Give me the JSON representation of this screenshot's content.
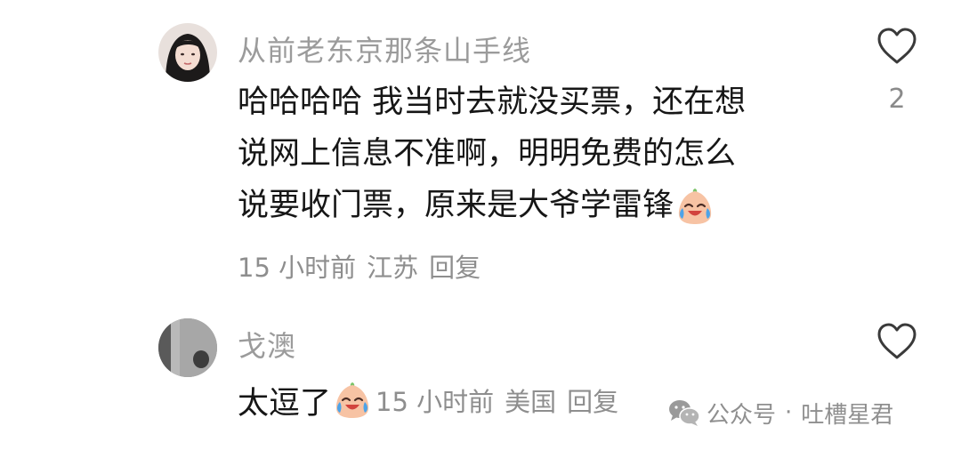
{
  "comments": [
    {
      "username": "从前老东京那条山手线",
      "body_lines": [
        "哈哈哈哈 我当时去就没买票，还在想",
        "说网上信息不准啊，明明免费的怎么",
        "说要收门票，原来是大爷学雷锋"
      ],
      "emoji_icon": "crying-laughing-emoji-icon",
      "time": "15 小时前",
      "location": "江苏",
      "reply_label": "回复",
      "like_count": "2",
      "heart_icon": "heart-outline-icon"
    },
    {
      "username": "戈澳",
      "text": "太逗了",
      "emoji_icon": "crying-laughing-emoji-icon",
      "time": "15 小时前",
      "location": "美国",
      "reply_label": "回复",
      "heart_icon": "heart-outline-icon"
    }
  ],
  "watermark": {
    "icon": "wechat-icon",
    "label": "公众号",
    "separator": "·",
    "account": "吐槽星君"
  },
  "colors": {
    "username": "#9b9b9b",
    "body_text": "#161616",
    "meta_text": "#8e8e8e",
    "icon_stroke": "#3a3a3a"
  }
}
